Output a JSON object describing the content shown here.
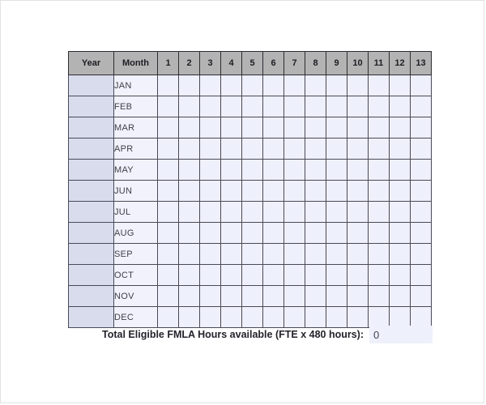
{
  "table": {
    "headers": {
      "year": "Year",
      "month": "Month",
      "numbers": [
        "1",
        "2",
        "3",
        "4",
        "5",
        "6",
        "7",
        "8",
        "9",
        "10",
        "11",
        "12",
        "13"
      ]
    },
    "rows": [
      {
        "year": "",
        "month": "JAN",
        "values": [
          "",
          "",
          "",
          "",
          "",
          "",
          "",
          "",
          "",
          "",
          "",
          "",
          ""
        ]
      },
      {
        "year": "",
        "month": "FEB",
        "values": [
          "",
          "",
          "",
          "",
          "",
          "",
          "",
          "",
          "",
          "",
          "",
          "",
          ""
        ]
      },
      {
        "year": "",
        "month": "MAR",
        "values": [
          "",
          "",
          "",
          "",
          "",
          "",
          "",
          "",
          "",
          "",
          "",
          "",
          ""
        ]
      },
      {
        "year": "",
        "month": "APR",
        "values": [
          "",
          "",
          "",
          "",
          "",
          "",
          "",
          "",
          "",
          "",
          "",
          "",
          ""
        ]
      },
      {
        "year": "",
        "month": "MAY",
        "values": [
          "",
          "",
          "",
          "",
          "",
          "",
          "",
          "",
          "",
          "",
          "",
          "",
          ""
        ]
      },
      {
        "year": "",
        "month": "JUN",
        "values": [
          "",
          "",
          "",
          "",
          "",
          "",
          "",
          "",
          "",
          "",
          "",
          "",
          ""
        ]
      },
      {
        "year": "",
        "month": "JUL",
        "values": [
          "",
          "",
          "",
          "",
          "",
          "",
          "",
          "",
          "",
          "",
          "",
          "",
          ""
        ]
      },
      {
        "year": "",
        "month": "AUG",
        "values": [
          "",
          "",
          "",
          "",
          "",
          "",
          "",
          "",
          "",
          "",
          "",
          "",
          ""
        ]
      },
      {
        "year": "",
        "month": "SEP",
        "values": [
          "",
          "",
          "",
          "",
          "",
          "",
          "",
          "",
          "",
          "",
          "",
          "",
          ""
        ]
      },
      {
        "year": "",
        "month": "OCT",
        "values": [
          "",
          "",
          "",
          "",
          "",
          "",
          "",
          "",
          "",
          "",
          "",
          "",
          ""
        ]
      },
      {
        "year": "",
        "month": "NOV",
        "values": [
          "",
          "",
          "",
          "",
          "",
          "",
          "",
          "",
          "",
          "",
          "",
          "",
          ""
        ]
      },
      {
        "year": "",
        "month": "DEC",
        "values": [
          "",
          "",
          "",
          "",
          "",
          "",
          "",
          "",
          "",
          "",
          "",
          "",
          ""
        ]
      }
    ]
  },
  "footer": {
    "label": "Total Eligible FMLA Hours available (FTE x 480 hours):",
    "value": "0"
  },
  "colors": {
    "header_fill": "#b3b3b3",
    "year_cell_fill": "#d9dced",
    "month_cell_fill": "#f1f2fb",
    "data_cell_fill": "#eef0fb",
    "grid_line": "#4a4a57",
    "page_border": "#e2e2e2"
  }
}
